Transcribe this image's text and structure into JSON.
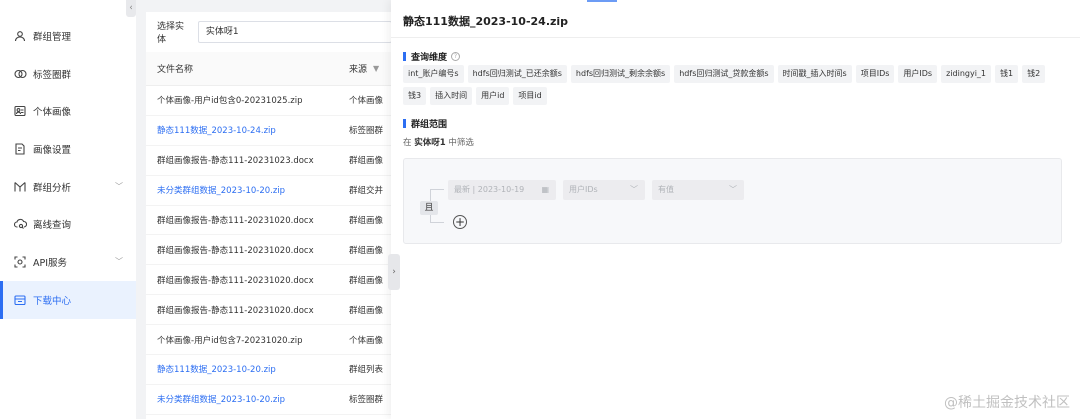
{
  "sidebar": {
    "collapse_icon": "‹",
    "items": [
      {
        "label": "群组管理",
        "icon": "people-icon",
        "chevron": false
      },
      {
        "label": "标签圈群",
        "icon": "tag-circle-icon",
        "chevron": false
      },
      {
        "label": "个体画像",
        "icon": "portrait-icon",
        "chevron": false
      },
      {
        "label": "画像设置",
        "icon": "settings-doc-icon",
        "chevron": false
      },
      {
        "label": "群组分析",
        "icon": "analysis-icon",
        "chevron": true
      },
      {
        "label": "离线查询",
        "icon": "cloud-search-icon",
        "chevron": false
      },
      {
        "label": "API服务",
        "icon": "api-icon",
        "chevron": true
      },
      {
        "label": "下载中心",
        "icon": "download-icon",
        "chevron": false,
        "active": true
      }
    ]
  },
  "list": {
    "filter_label": "选择实体",
    "filter_value": "实体呀1",
    "col_name": "文件名称",
    "col_source": "来源",
    "rows": [
      {
        "name": "个体画像-用户id包含0-20231025.zip",
        "source": "个体画像",
        "link": false
      },
      {
        "name": "静态111数据_2023-10-24.zip",
        "source": "标签圈群",
        "link": true
      },
      {
        "name": "群组画像报告-静态111-20231023.docx",
        "source": "群组画像",
        "link": false
      },
      {
        "name": "未分类群组数据_2023-10-20.zip",
        "source": "群组交并",
        "link": true
      },
      {
        "name": "群组画像报告-静态111-20231020.docx",
        "source": "群组画像",
        "link": false
      },
      {
        "name": "群组画像报告-静态111-20231020.docx",
        "source": "群组画像",
        "link": false
      },
      {
        "name": "群组画像报告-静态111-20231020.docx",
        "source": "群组画像",
        "link": false
      },
      {
        "name": "群组画像报告-静态111-20231020.docx",
        "source": "群组画像",
        "link": false
      },
      {
        "name": "个体画像-用户id包含7-20231020.zip",
        "source": "个体画像",
        "link": false
      },
      {
        "name": "静态111数据_2023-10-20.zip",
        "source": "群组列表",
        "link": true
      },
      {
        "name": "未分类群组数据_2023-10-20.zip",
        "source": "标签圈群",
        "link": true
      }
    ]
  },
  "drawer": {
    "title": "静态111数据_2023-10-24.zip",
    "tab_icon": "›",
    "dims_title": "查询维度",
    "dims": [
      "int_账户编号s",
      "hdfs回归测试_已还余额s",
      "hdfs回归测试_剩余余额s",
      "hdfs回归测试_贷款金额s",
      "时间戳_插入时间s",
      "项目IDs",
      "用户IDs",
      "zidingyi_1",
      "钱1",
      "钱2",
      "钱3",
      "插入时间",
      "用户id",
      "项目id"
    ],
    "scope_title": "群组范围",
    "scope_prefix": "在",
    "scope_entity": "实体呀1",
    "scope_suffix": "中筛选",
    "and_label": "且",
    "cond_date": "最新 | 2023-10-19",
    "cond_field": "用户IDs",
    "cond_op": "有值",
    "add_icon": "+"
  },
  "watermark": "@稀土掘金技术社区"
}
